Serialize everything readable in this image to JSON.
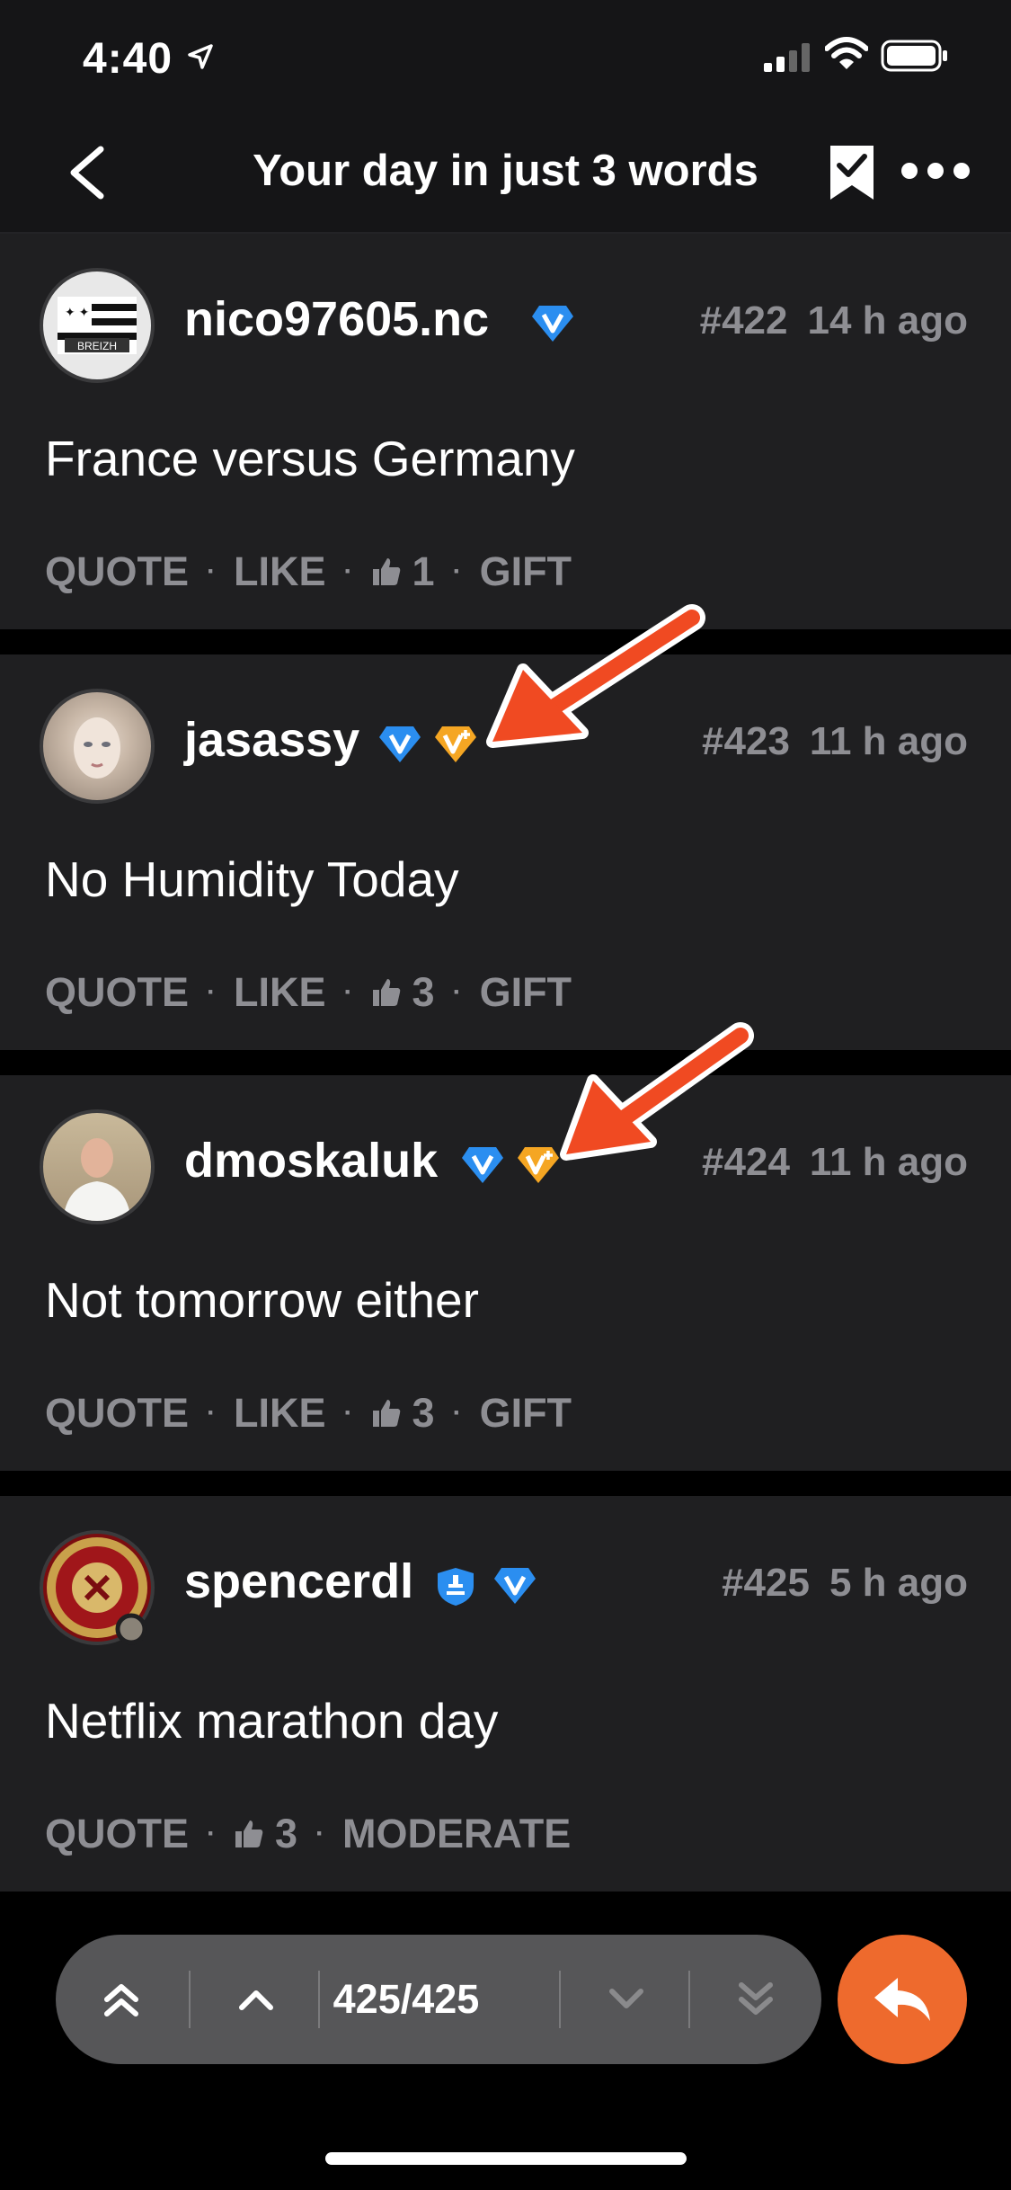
{
  "status": {
    "time": "4:40"
  },
  "nav": {
    "title": "Your day in just 3 words"
  },
  "posts": [
    {
      "username": "nico97605.nc",
      "number": "#422",
      "ago": "14 h ago",
      "content": "France versus Germany",
      "actions": {
        "quote": "QUOTE",
        "like": "LIKE",
        "likes": "1",
        "gift": "GIFT"
      }
    },
    {
      "username": "jasassy",
      "number": "#423",
      "ago": "11 h ago",
      "content": "No Humidity Today",
      "actions": {
        "quote": "QUOTE",
        "like": "LIKE",
        "likes": "3",
        "gift": "GIFT"
      }
    },
    {
      "username": "dmoskaluk",
      "number": "#424",
      "ago": "11 h ago",
      "content": "Not tomorrow either",
      "actions": {
        "quote": "QUOTE",
        "like": "LIKE",
        "likes": "3",
        "gift": "GIFT"
      }
    },
    {
      "username": "spencerdl",
      "number": "#425",
      "ago": "5 h ago",
      "content": "Netflix marathon day",
      "actions": {
        "quote": "QUOTE",
        "likes": "3",
        "moderate": "MODERATE"
      }
    }
  ],
  "pager": {
    "count": "425/425"
  },
  "colors": {
    "accent": "#ee6a2d",
    "verified": "#2b8ef0",
    "vip": "#f5a623",
    "arrow": "#f04a22"
  }
}
